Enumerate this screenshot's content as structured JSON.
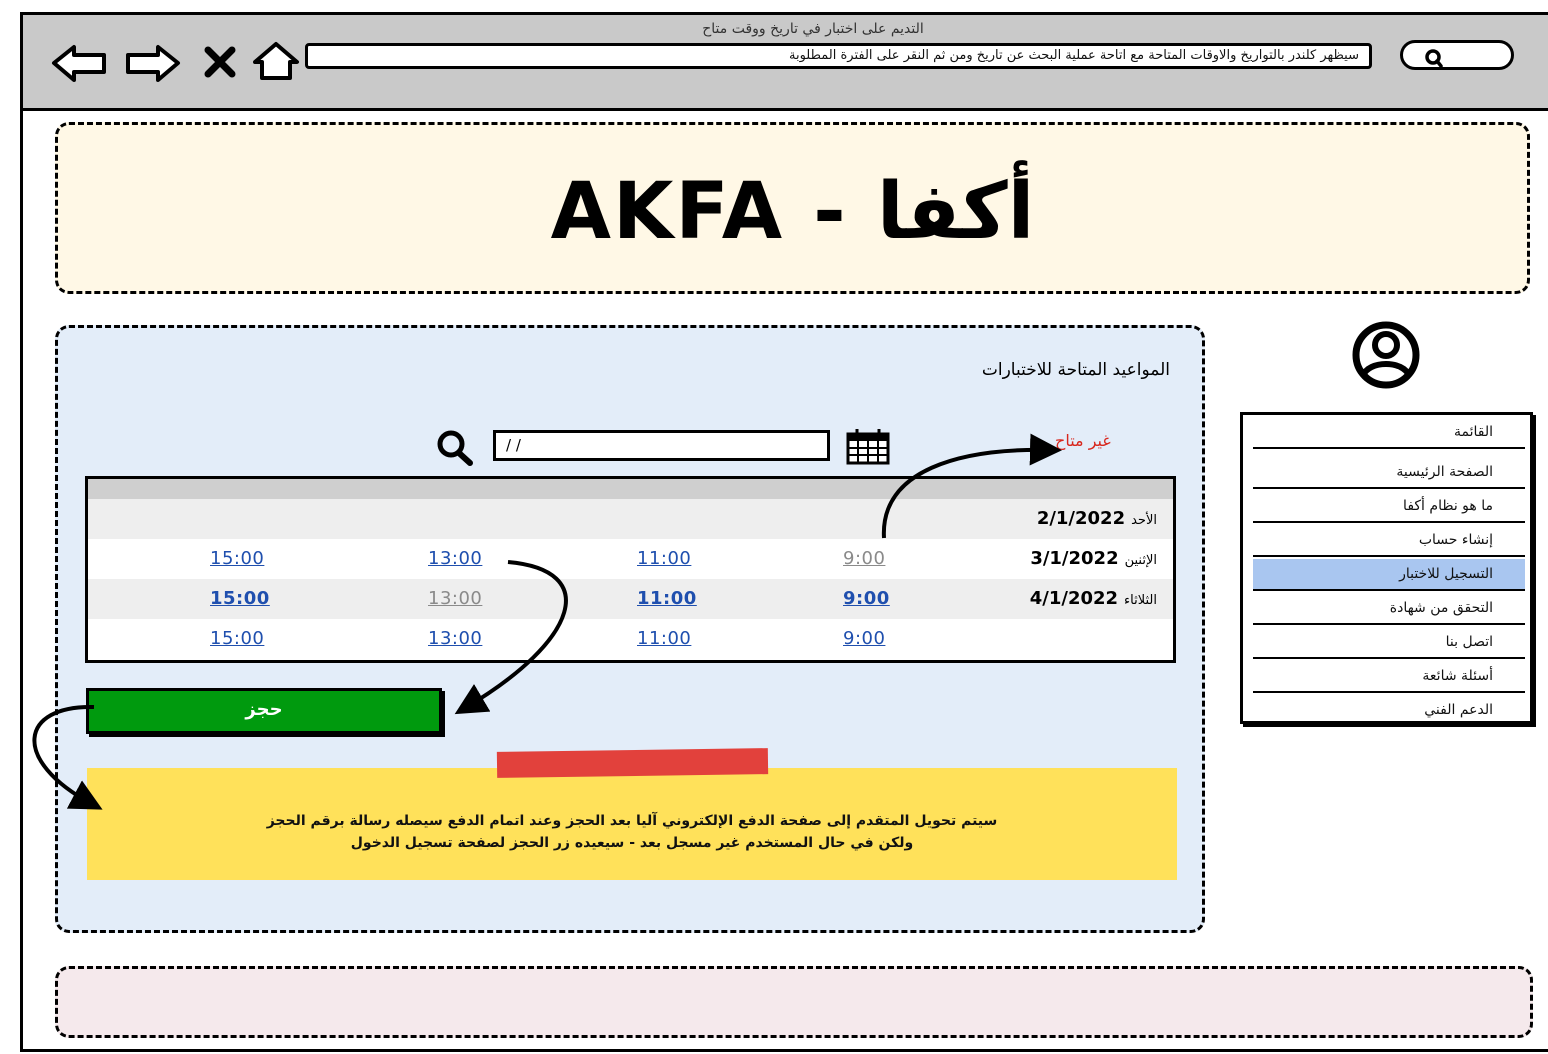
{
  "window": {
    "title": "التديم على اختبار في تاريخ ووقت متاح",
    "url": "سيظهر كلندر بالتواريخ والاوقات المتاحة مع اتاحة عملية البحث عن تاريخ ومن ثم النقر على الفترة المطلوبة"
  },
  "nav": {
    "back_icon": "arrow-left-icon",
    "forward_icon": "arrow-right-icon",
    "stop_icon": "close-icon",
    "home_icon": "home-icon",
    "search_icon": "search-icon"
  },
  "header": {
    "logo": "AKFA - أكفا"
  },
  "main": {
    "title": "المواعيد المتاحة للاختبارات",
    "unavailable_label": "غير متاح",
    "search": {
      "value": "/ /",
      "calendar_icon": "calendar-icon",
      "search_icon": "search-icon"
    },
    "schedule": [
      {
        "day": "الأحد",
        "date": "2/1/2022",
        "times": []
      },
      {
        "day": "الإثنين",
        "date": "3/1/2022",
        "times": [
          {
            "label": "9:00",
            "available": false
          },
          {
            "label": "11:00",
            "available": true
          },
          {
            "label": "13:00",
            "available": true
          },
          {
            "label": "15:00",
            "available": true
          }
        ]
      },
      {
        "day": "الثلاثاء",
        "date": "4/1/2022",
        "times": [
          {
            "label": "9:00",
            "available": true
          },
          {
            "label": "11:00",
            "available": true
          },
          {
            "label": "13:00",
            "available": false
          },
          {
            "label": "15:00",
            "available": true
          }
        ]
      },
      {
        "day": "",
        "date": "",
        "times": [
          {
            "label": "9:00",
            "available": true
          },
          {
            "label": "11:00",
            "available": true
          },
          {
            "label": "13:00",
            "available": true
          },
          {
            "label": "15:00",
            "available": true
          }
        ]
      }
    ],
    "book_button": "حجز",
    "note_line1": "سيتم تحويل المتقدم إلى صفحة الدفع الإلكتروني آليا بعد الحجز وعند اتمام الدفع سيصله رسالة برقم الحجز",
    "note_line2": "ولكن في حال المستخدم غير مسجل بعد - سيعيده زر الحجز لصفحة تسجيل الدخول"
  },
  "sidebar": {
    "avatar_icon": "user-avatar-icon",
    "items": [
      {
        "label": "القائمة",
        "type": "header"
      },
      {
        "label": "الصفحة الرئيسية"
      },
      {
        "label": "ما هو نظام أكفا"
      },
      {
        "label": "إنشاء حساب"
      },
      {
        "label": "التسجيل للاختبار",
        "active": true
      },
      {
        "label": "التحقق من شهادة"
      },
      {
        "label": "اتصل بنا"
      },
      {
        "label": "أسئلة شائعة"
      },
      {
        "label": "الدعم الفني"
      }
    ]
  },
  "colors": {
    "header_bg": "#fff8e6",
    "content_bg": "#e3edf9",
    "footer_bg": "#f5e9ec",
    "book_button": "#009a0e",
    "note_bg": "#ffe15a",
    "active_menu": "#a9c6f0",
    "unavailable": "#d8281e",
    "time_link": "#1f4fae"
  }
}
